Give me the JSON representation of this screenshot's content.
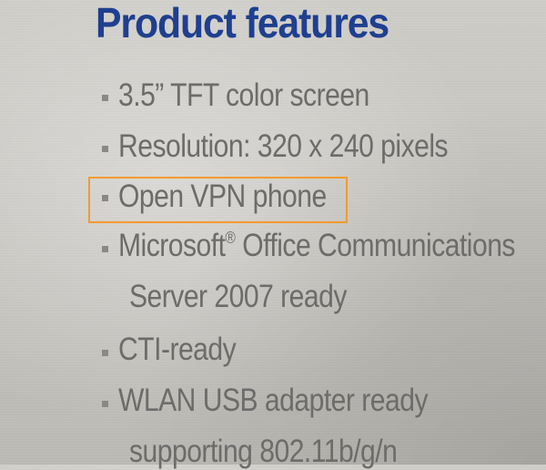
{
  "title": "Product features",
  "features": [
    {
      "text": "3.5” TFT color screen"
    },
    {
      "text": "Resolution: 320 x 240 pixels"
    },
    {
      "text": "Open VPN phone",
      "highlighted": true
    },
    {
      "text_before_sup": "Microsoft",
      "sup": "®",
      "text_after_sup": " Office Communications",
      "line2": "Server 2007 ready"
    },
    {
      "text": "CTI-ready"
    },
    {
      "text": "WLAN USB adapter ready",
      "line2": "supporting 802.11b/g/n"
    }
  ],
  "colors": {
    "title": "#1f3f8f",
    "body_text": "#6d6c6a",
    "highlight_border": "#f29b2e"
  }
}
